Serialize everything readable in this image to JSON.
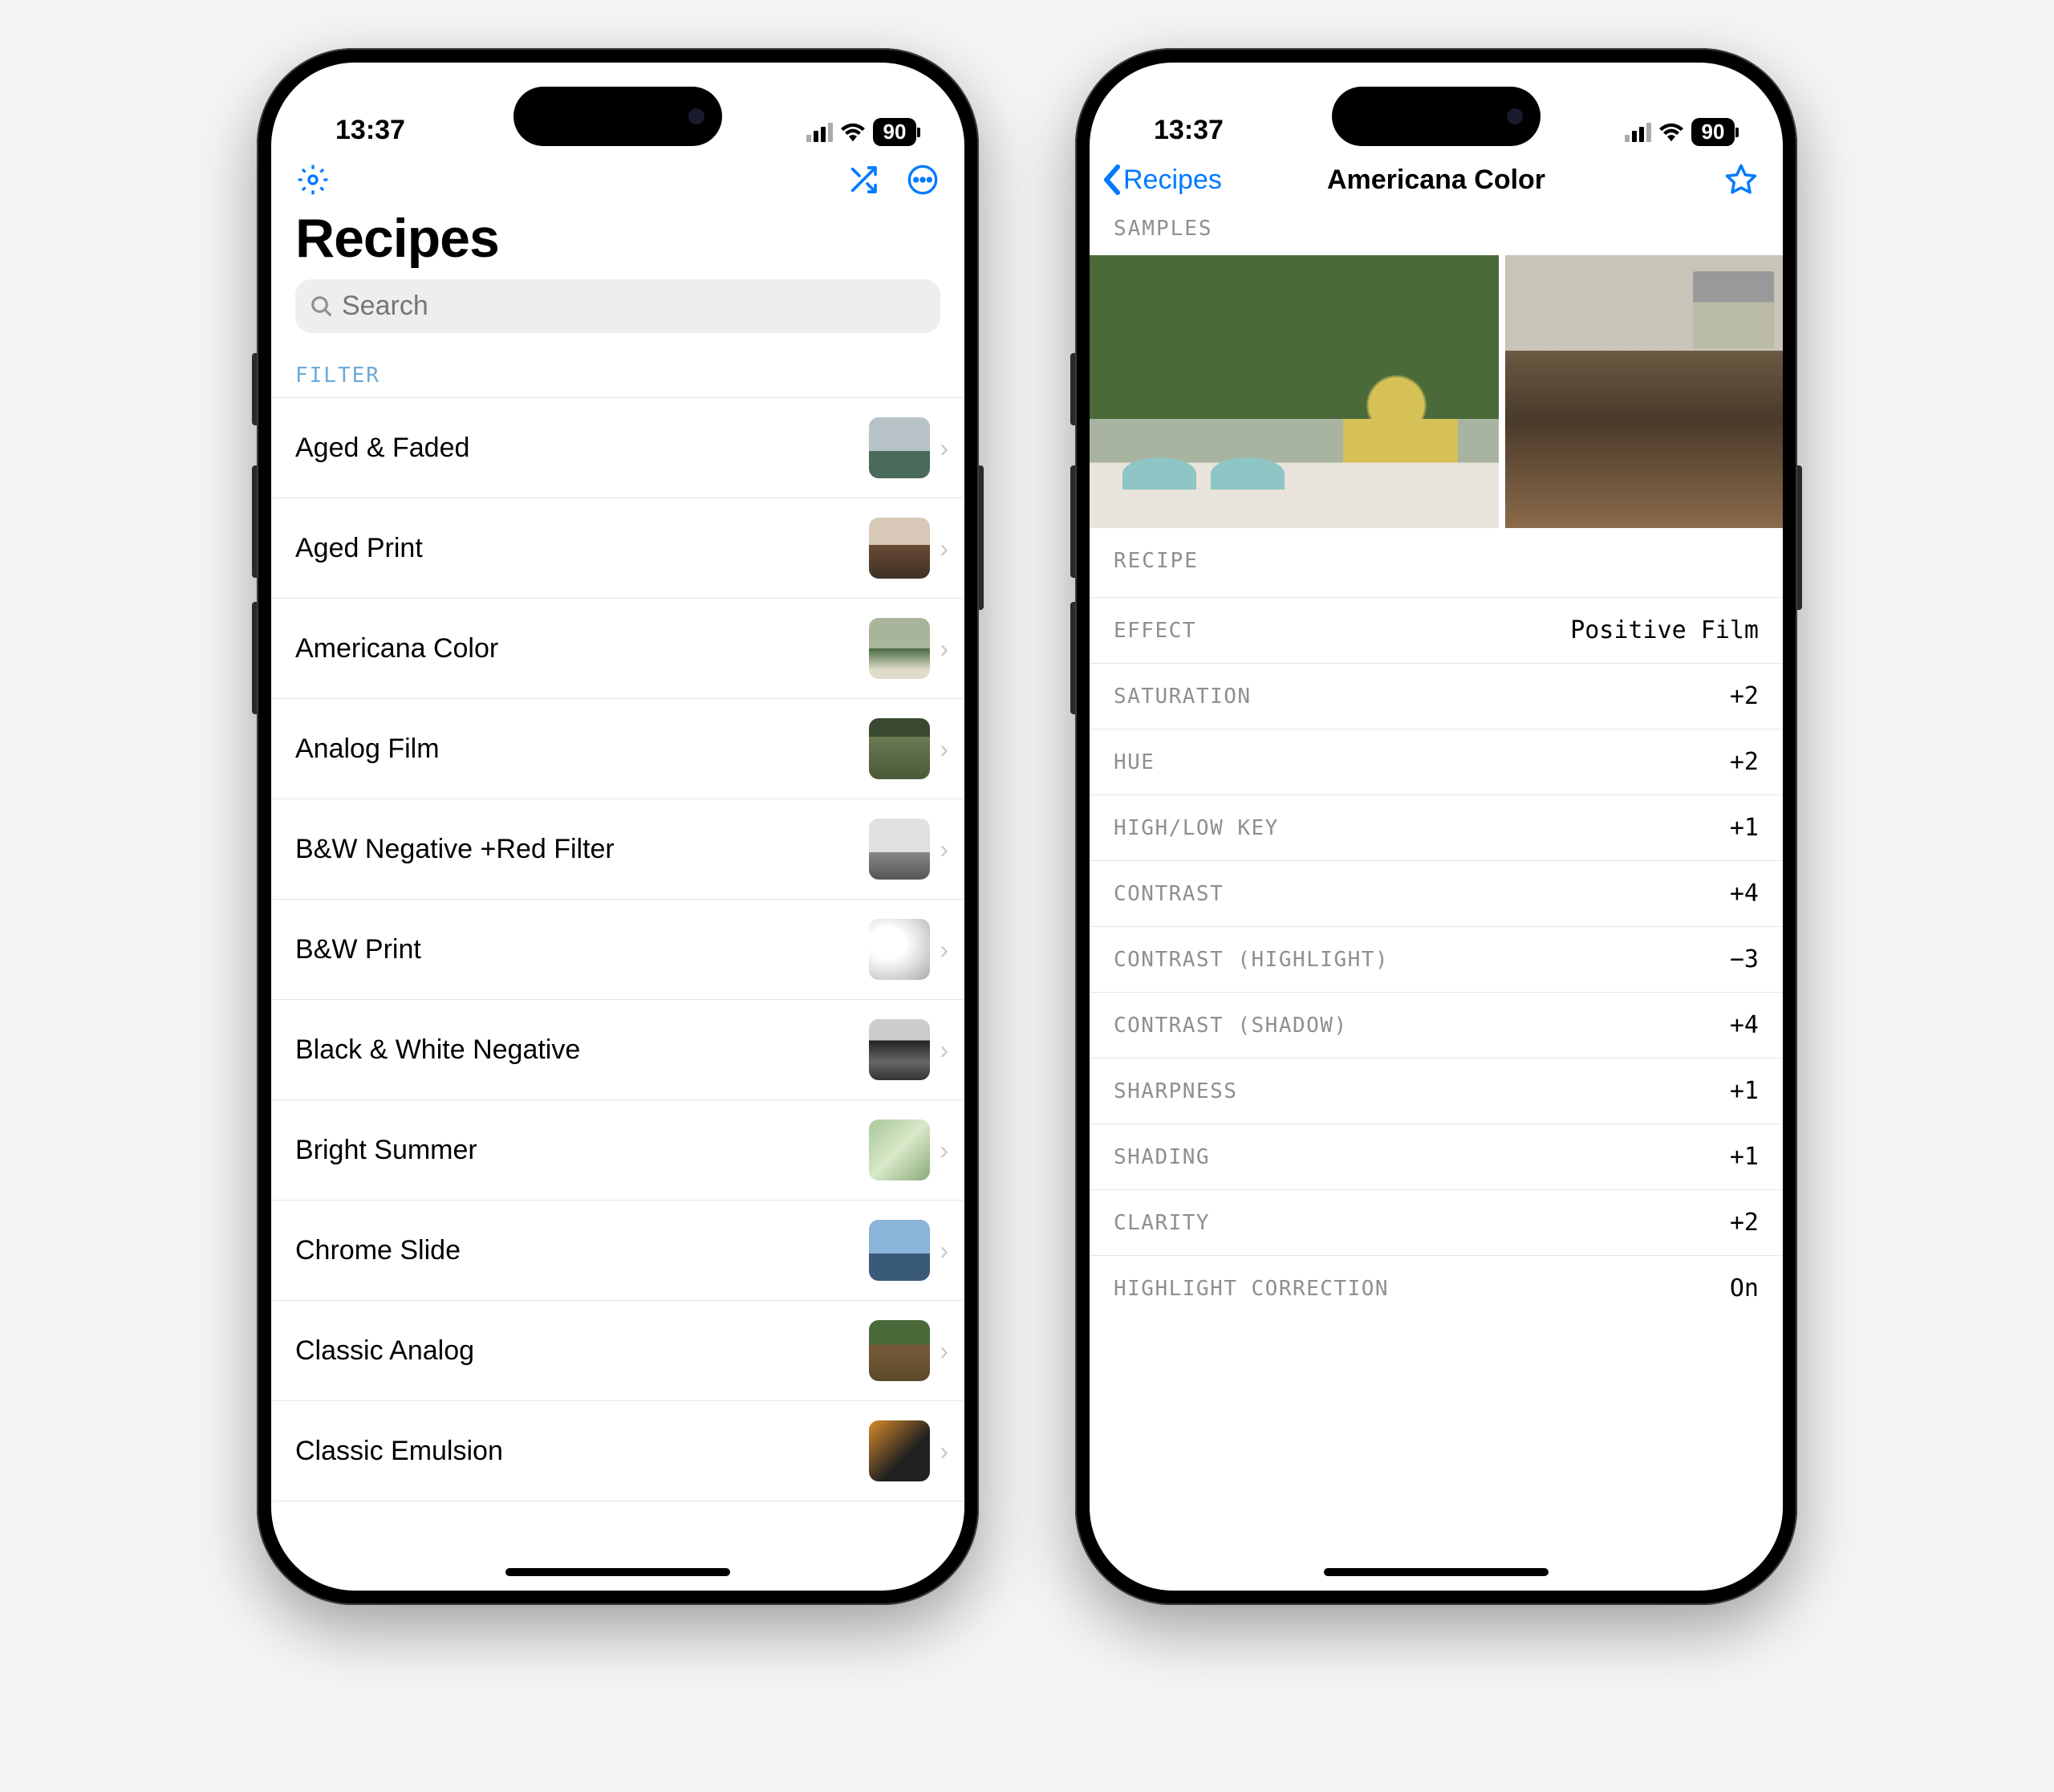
{
  "status": {
    "time": "13:37",
    "battery": "90"
  },
  "accent": "#007aff",
  "list_screen": {
    "title": "Recipes",
    "search_placeholder": "Search",
    "section_header": "FILTER",
    "items": [
      {
        "label": "Aged & Faded"
      },
      {
        "label": "Aged Print"
      },
      {
        "label": "Americana Color"
      },
      {
        "label": "Analog Film"
      },
      {
        "label": "B&W Negative +Red Filter"
      },
      {
        "label": "B&W Print"
      },
      {
        "label": "Black & White Negative"
      },
      {
        "label": "Bright Summer"
      },
      {
        "label": "Chrome Slide"
      },
      {
        "label": "Classic Analog"
      },
      {
        "label": "Classic Emulsion"
      }
    ]
  },
  "detail_screen": {
    "back_label": "Recipes",
    "title": "Americana Color",
    "samples_header": "SAMPLES",
    "recipe_header": "RECIPE",
    "params": [
      {
        "label": "EFFECT",
        "value": "Positive Film"
      },
      {
        "label": "SATURATION",
        "value": "+2"
      },
      {
        "label": "HUE",
        "value": "+2"
      },
      {
        "label": "HIGH/LOW KEY",
        "value": "+1"
      },
      {
        "label": "CONTRAST",
        "value": "+4"
      },
      {
        "label": "CONTRAST (HIGHLIGHT)",
        "value": "−3"
      },
      {
        "label": "CONTRAST (SHADOW)",
        "value": "+4"
      },
      {
        "label": "SHARPNESS",
        "value": "+1"
      },
      {
        "label": "SHADING",
        "value": "+1"
      },
      {
        "label": "CLARITY",
        "value": "+2"
      },
      {
        "label": "HIGHLIGHT CORRECTION",
        "value": "On"
      }
    ]
  }
}
